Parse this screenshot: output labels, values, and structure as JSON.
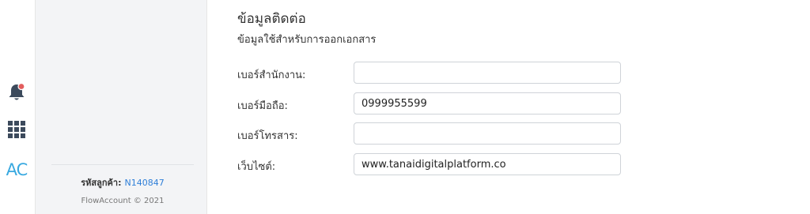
{
  "rail": {
    "icons": [
      "bell-icon",
      "apps-grid-icon"
    ],
    "avatar_text": "AC",
    "notification_color": "#e35d5d",
    "icon_color": "#3c4a5c"
  },
  "sidebar": {
    "customer_code_label": "รหัสลูกค้า:",
    "customer_code": "N140847",
    "copyright": "FlowAccount © 2021"
  },
  "contact": {
    "title": "ข้อมูลติดต่อ",
    "subtitle": "ข้อมูลใช้สำหรับการออกเอกสาร",
    "fields": [
      {
        "label": "เบอร์สำนักงาน:",
        "value": ""
      },
      {
        "label": "เบอร์มือถือ:",
        "value": "0999955599"
      },
      {
        "label": "เบอร์โทรสาร:",
        "value": ""
      },
      {
        "label": "เว็บไซต์:",
        "value": "www.tanaidigitalplatform.co"
      }
    ]
  }
}
